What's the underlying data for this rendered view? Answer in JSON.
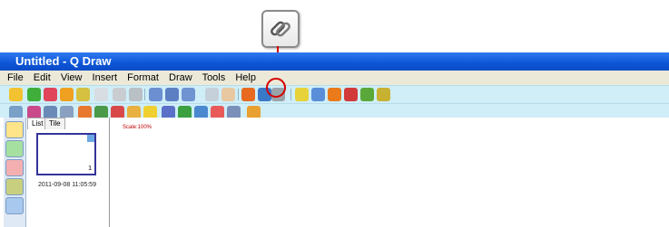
{
  "window": {
    "title": "Untitled - Q Draw"
  },
  "menu": [
    "File",
    "Edit",
    "View",
    "Insert",
    "Format",
    "Draw",
    "Tools",
    "Help"
  ],
  "panel": {
    "tabs": [
      "List",
      "Tile"
    ],
    "thumbnail": {
      "page_number": "1",
      "timestamp": "2011-09-08 11:05:59"
    }
  },
  "canvas": {
    "scale_label": "Scale:100%"
  },
  "colors": {
    "title_bar": "#0d55d6",
    "toolbar_bg": "#cfeef8",
    "callout": "#d40000",
    "scale_text": "#c00000"
  }
}
